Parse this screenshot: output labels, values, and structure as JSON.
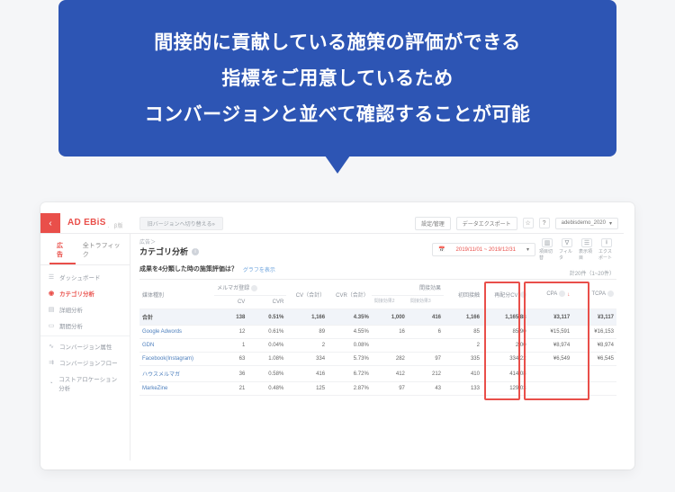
{
  "bubble": {
    "line1": "間接的に貢献している施策の評価ができる",
    "line2": "指標をご用意しているため",
    "line3": "コンバージョンと並べて確認することが可能"
  },
  "brand": {
    "name": "AD EBiS",
    "suffix": "β版"
  },
  "top": {
    "legacy": "旧バージョンへ切り替える»",
    "settings": "設定/管理",
    "export": "データエクスポート",
    "account": "adebisdemo_2020"
  },
  "tabs": {
    "ads": "広告",
    "all_traffic": "全トラフィック"
  },
  "nav": {
    "dashboard": "ダッシュボード",
    "category": "カテゴリ分析",
    "detail": "詳細分析",
    "period": "期間分析",
    "cv_attr": "コンバージョン属性",
    "cv_flow": "コンバージョンフロー",
    "cost": "コストアロケーション分析"
  },
  "main": {
    "crumb": "広告＞",
    "title": "カテゴリ分析",
    "daterange": "2019/11/01 ~ 2019/12/31",
    "ctrl_labels": {
      "c1": "項目切替",
      "c2": "フィルタ",
      "c3": "表示項目",
      "c4": "エクスポート"
    },
    "question": "成果を4分類した時の施策評価は？",
    "graph_link": "グラフを表示",
    "counter": "計20件（1~20件）"
  },
  "columns": {
    "media": "媒体種別",
    "mailmag": "メルマガ登録",
    "cv": "CV",
    "cvr": "CVR",
    "cv_total": "CV（合計）",
    "cvr_total": "CVR（合計）",
    "indirect": "間接効果",
    "indirect2": "間接効果2",
    "indirect3": "間接効果3",
    "first_touch": "初回接触",
    "recv": "再配分CV",
    "cpa": "CPA",
    "tcpa": "TCPA"
  },
  "rows": [
    {
      "name": "合計",
      "is_total": true,
      "cv": "138",
      "cvr": "0.51%",
      "cvt": "1,166",
      "cvrt": "4.35%",
      "ind1": "1,000",
      "ind2": "416",
      "first": "1,166",
      "recv": "1,165.88",
      "cpa": "¥3,117",
      "tcpa": "¥3,117"
    },
    {
      "name": "Google Adwords",
      "cv": "12",
      "cvr": "0.61%",
      "cvt": "89",
      "cvrt": "4.55%",
      "ind1": "16",
      "ind2": "6",
      "first": "85",
      "recv": "85.90",
      "cpa": "¥15,591",
      "tcpa": "¥16,153"
    },
    {
      "name": "GDN",
      "cv": "1",
      "cvr": "0.04%",
      "cvt": "2",
      "cvrt": "0.08%",
      "ind1": "",
      "ind2": "",
      "first": "2",
      "recv": "2.00",
      "cpa": "¥8,974",
      "tcpa": "¥8,974"
    },
    {
      "name": "Facebook(Instagram)",
      "cv": "63",
      "cvr": "1.08%",
      "cvt": "334",
      "cvrt": "5.73%",
      "ind1": "282",
      "ind2": "97",
      "first": "335",
      "recv": "334.22",
      "cpa": "¥6,549",
      "tcpa": "¥6,545"
    },
    {
      "name": "ハウスメルマガ",
      "cv": "36",
      "cvr": "0.58%",
      "cvt": "416",
      "cvrt": "6.72%",
      "ind1": "412",
      "ind2": "212",
      "first": "410",
      "recv": "414.08",
      "cpa": "",
      "tcpa": ""
    },
    {
      "name": "MarkeZine",
      "cv": "21",
      "cvr": "0.48%",
      "cvt": "125",
      "cvrt": "2.87%",
      "ind1": "97",
      "ind2": "43",
      "first": "133",
      "recv": "129.03",
      "cpa": "",
      "tcpa": ""
    }
  ]
}
